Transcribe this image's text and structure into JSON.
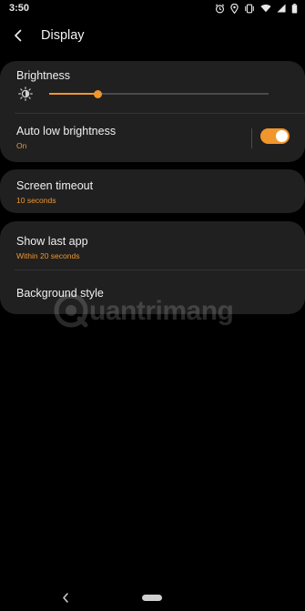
{
  "status_bar": {
    "time": "3:50",
    "icons": [
      "alarm-icon",
      "location-icon",
      "vibrate-icon",
      "wifi-icon",
      "signal-icon",
      "battery-icon"
    ]
  },
  "appbar": {
    "back_icon": "arrow-back-icon",
    "title": "Display"
  },
  "settings": {
    "brightness": {
      "title": "Brightness",
      "icon": "brightness-low-icon",
      "level": 0.22
    },
    "auto_low_brightness": {
      "title": "Auto low brightness",
      "status": "On",
      "enabled": true
    },
    "screen_timeout": {
      "title": "Screen timeout",
      "value": "10 seconds"
    },
    "show_last_app": {
      "title": "Show last app",
      "value": "Within 20 seconds"
    },
    "background_style": {
      "title": "Background style"
    }
  },
  "watermark": {
    "text": "uantrimang"
  },
  "navbar": {
    "back_icon": "nav-back-icon",
    "home_icon": "home-pill-icon"
  },
  "colors": {
    "accent": "#f0962d",
    "card": "#202020",
    "background": "#000000"
  }
}
